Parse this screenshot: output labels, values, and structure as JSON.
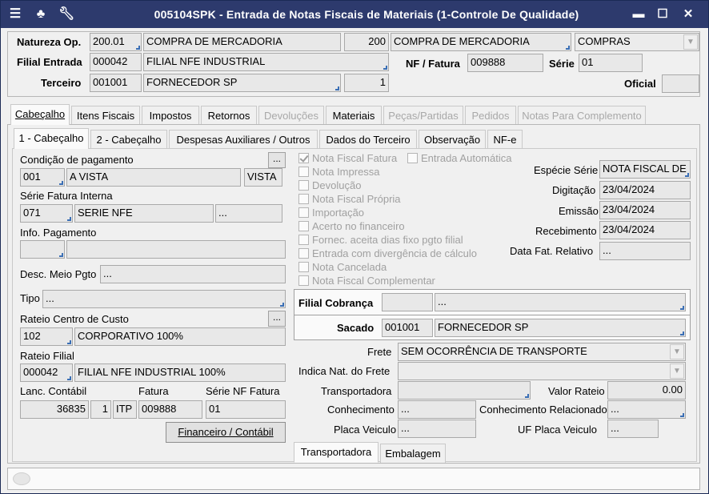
{
  "window": {
    "title": "005104SPK - Entrada de Notas Fiscais de Materiais (1-Controle De Qualidade)"
  },
  "header": {
    "natureza_label": "Natureza Op.",
    "natureza_code": "200.01",
    "natureza_desc": "COMPRA DE MERCADORIA",
    "natureza_code2": "200",
    "natureza_desc2": "COMPRA DE MERCADORIA",
    "natureza_tipo": "COMPRAS",
    "filial_label": "Filial Entrada",
    "filial_code": "000042",
    "filial_desc": "FILIAL NFE INDUSTRIAL",
    "nf_label": "NF / Fatura",
    "nf_value": "009888",
    "serie_label": "Série",
    "serie_value": "01",
    "terceiro_label": "Terceiro",
    "terceiro_code": "001001",
    "terceiro_desc": "FORNECEDOR SP",
    "terceiro_seq": "1",
    "oficial_label": "Oficial",
    "oficial_value": ""
  },
  "main_tabs": [
    {
      "label": "Cabeçalho"
    },
    {
      "label": "Itens Fiscais"
    },
    {
      "label": "Impostos"
    },
    {
      "label": "Retornos"
    },
    {
      "label": "Devoluções"
    },
    {
      "label": "Materiais"
    },
    {
      "label": "Peças/Partidas"
    },
    {
      "label": "Pedidos"
    },
    {
      "label": "Notas Para Complemento"
    }
  ],
  "sub_tabs": [
    {
      "label": "1 - Cabeçalho"
    },
    {
      "label": "2 - Cabeçalho"
    },
    {
      "label": "Despesas Auxiliares / Outros"
    },
    {
      "label": "Dados do Terceiro"
    },
    {
      "label": "Observação"
    },
    {
      "label": "NF-e"
    }
  ],
  "left": {
    "cond_label": "Condição de pagamento",
    "cond_code": "001",
    "cond_desc": "A VISTA",
    "cond_tipo": "VISTA",
    "serie_fat_label": "Série Fatura Interna",
    "serie_fat_code": "071",
    "serie_fat_desc": "SERIE NFE",
    "serie_fat_extra": "...",
    "info_label": "Info. Pagamento",
    "desc_meio_label": "Desc. Meio Pgto",
    "desc_meio_value": "...",
    "tipo_label": "Tipo",
    "tipo_value": "...",
    "rateio_cc_label": "Rateio Centro de Custo",
    "rateio_cc_code": "102",
    "rateio_cc_desc": "CORPORATIVO 100%",
    "rateio_filial_label": "Rateio Filial",
    "rateio_filial_code": "000042",
    "rateio_filial_desc": "FILIAL NFE INDUSTRIAL 100%",
    "lanc_label": "Lanc. Contábil",
    "fatura_label": "Fatura",
    "serie_nf_fat_label": "Série NF Fatura",
    "lanc_value": "36835",
    "lanc_seq": "1",
    "lanc_tipo": "ITP",
    "fatura_value": "009888",
    "serie_nf_fat_value": "01",
    "fin_button": "Financeiro / Contábil",
    "dots": "..."
  },
  "checks": [
    {
      "label": "Nota Fiscal Fatura",
      "checked": true
    },
    {
      "label": "Nota Impressa",
      "checked": false
    },
    {
      "label": "Devolução",
      "checked": false
    },
    {
      "label": "Nota Fiscal Própria",
      "checked": false
    },
    {
      "label": "Importação",
      "checked": false
    },
    {
      "label": "Acerto no financeiro",
      "checked": false
    },
    {
      "label": "Fornec. aceita dias fixo pgto filial",
      "checked": false
    },
    {
      "label": "Entrada com divergência de cálculo",
      "checked": false
    },
    {
      "label": "Nota Cancelada",
      "checked": false
    },
    {
      "label": "Nota Fiscal Complementar",
      "checked": false
    }
  ],
  "entrada_auto": {
    "label": "Entrada Automática",
    "checked": false
  },
  "right": {
    "especie_label": "Espécie Série",
    "especie_value": "NOTA FISCAL DE S",
    "digitacao_label": "Digitação",
    "digitacao_value": "23/04/2024",
    "emissao_label": "Emissão",
    "emissao_value": "23/04/2024",
    "recebimento_label": "Recebimento",
    "recebimento_value": "23/04/2024",
    "data_fat_label": "Data Fat. Relativo",
    "data_fat_value": "...",
    "filial_cob_label": "Filial Cobrança",
    "filial_cob_value": "...",
    "sacado_label": "Sacado",
    "sacado_code": "001001",
    "sacado_desc": "FORNECEDOR SP",
    "frete_label": "Frete",
    "frete_value": "SEM OCORRÊNCIA DE TRANSPORTE",
    "indica_label": "Indica Nat. do Frete",
    "transp_label": "Transportadora",
    "valor_rateio_label": "Valor Rateio",
    "valor_rateio_value": "0.00",
    "conhec_label": "Conhecimento",
    "conhec_value": "...",
    "conhec_rel_label": "Conhecimento Relacionado",
    "conhec_rel_value": "...",
    "placa_label": "Placa Veiculo",
    "placa_value": "...",
    "uf_placa_label": "UF Placa Veiculo",
    "uf_placa_value": "...",
    "bottom_tabs": [
      {
        "label": "Transportadora"
      },
      {
        "label": "Embalagem"
      }
    ]
  }
}
